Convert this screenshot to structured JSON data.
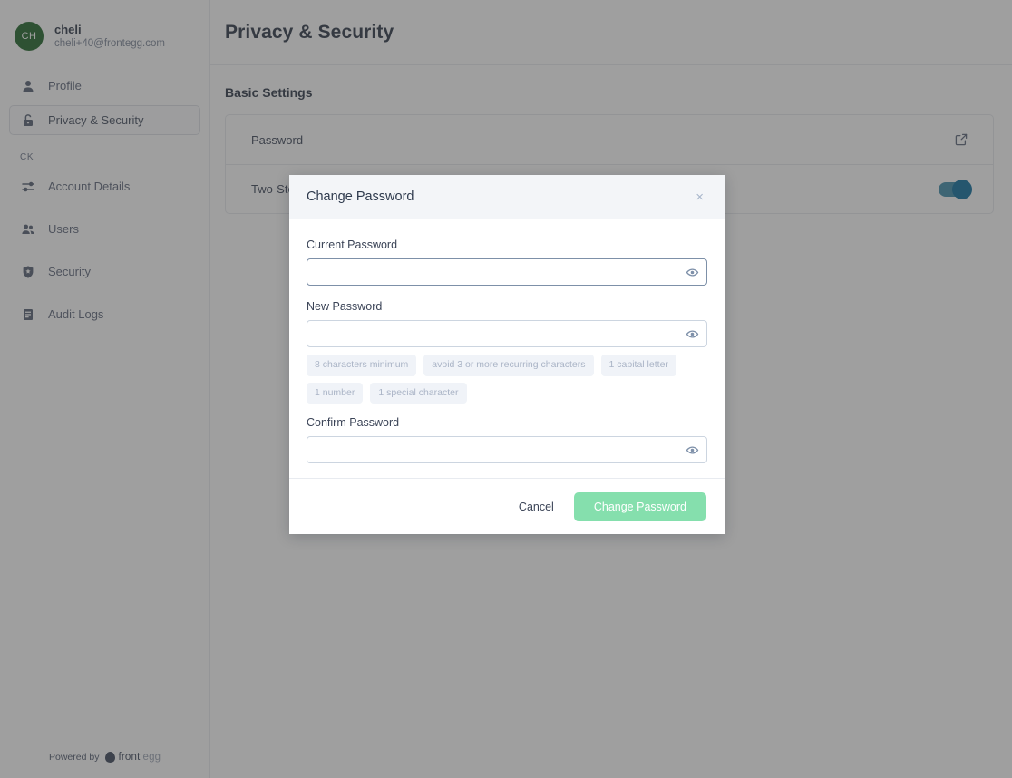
{
  "sidebar": {
    "user": {
      "initials": "CH",
      "name": "cheli",
      "email": "cheli+40@frontegg.com",
      "avatar_color": "#1d6327"
    },
    "primary_items": [
      {
        "label": "Profile",
        "icon": "person-icon",
        "active": false
      },
      {
        "label": "Privacy & Security",
        "icon": "unlock-icon",
        "active": true
      }
    ],
    "section_label": "CK",
    "group_items": [
      {
        "label": "Account Details",
        "icon": "sliders-icon"
      },
      {
        "label": "Users",
        "icon": "people-icon"
      },
      {
        "label": "Security",
        "icon": "shield-icon"
      },
      {
        "label": "Audit Logs",
        "icon": "document-list-icon"
      }
    ],
    "footer": {
      "powered_by": "Powered by",
      "brand_first": "front",
      "brand_second": "egg"
    }
  },
  "main": {
    "title": "Privacy & Security",
    "section_heading": "Basic Settings",
    "rows": [
      {
        "label": "Password",
        "control": "edit"
      },
      {
        "label": "Two-Step Login",
        "control": "toggle",
        "toggle_on": true
      }
    ]
  },
  "modal": {
    "title": "Change Password",
    "close_label": "×",
    "fields": [
      {
        "label": "Current Password",
        "value": "",
        "placeholder": "",
        "focused": true
      },
      {
        "label": "New Password",
        "value": "",
        "placeholder": "",
        "focused": false
      },
      {
        "label": "Confirm Password",
        "value": "",
        "placeholder": "",
        "focused": false
      }
    ],
    "requirements": [
      "8 characters minimum",
      "avoid 3 or more recurring characters",
      "1 capital letter",
      "1 number",
      "1 special character"
    ],
    "cancel_label": "Cancel",
    "submit_label": "Change Password",
    "submit_color": "#85dfad"
  }
}
